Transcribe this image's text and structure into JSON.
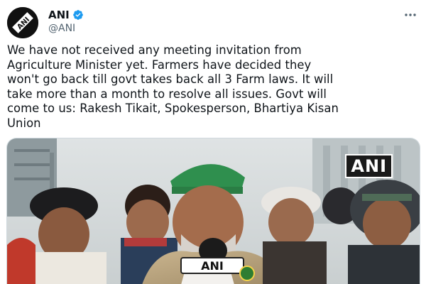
{
  "account": {
    "display_name": "ANI",
    "handle": "@ANI",
    "avatar_text": "ANI"
  },
  "tweet": {
    "text": "We have not received any meeting invitation from\nAgriculture Minister yet. Farmers have decided they\nwon't go back till govt takes back all 3 Farm laws. It will\ntake more than a month to resolve all issues. Govt will\ncome to us: Rakesh Tikait, Spokesperson, Bhartiya Kisan\nUnion"
  },
  "media": {
    "watermark": "ANI",
    "mic_label": "ANI"
  },
  "colors": {
    "verified": "#1d9bf0",
    "text": "#0f1419",
    "secondary": "#536471"
  }
}
